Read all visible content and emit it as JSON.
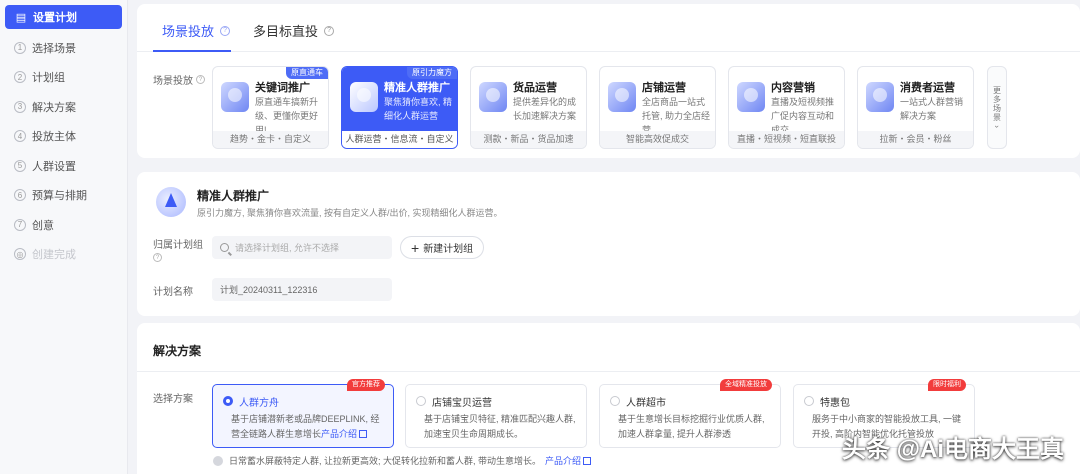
{
  "sidebar": {
    "steps": [
      {
        "num": "▤",
        "label": "设置计划"
      },
      {
        "num": "1",
        "label": "选择场景"
      },
      {
        "num": "2",
        "label": "计划组"
      },
      {
        "num": "3",
        "label": "解决方案"
      },
      {
        "num": "4",
        "label": "投放主体"
      },
      {
        "num": "5",
        "label": "人群设置"
      },
      {
        "num": "6",
        "label": "预算与排期"
      },
      {
        "num": "7",
        "label": "创意"
      },
      {
        "num": "◎",
        "label": "创建完成"
      }
    ]
  },
  "tabs": [
    {
      "label": "场景投放",
      "q": "?"
    },
    {
      "label": "多目标直投",
      "q": "?"
    }
  ],
  "scene": {
    "label": "场景投放",
    "q": "?",
    "cards": [
      {
        "title": "关键词推广",
        "desc": "原直通车搞新升级、更懂你更好用!",
        "foot": "趋势・金卡・自定义",
        "badge": "原直通车"
      },
      {
        "title": "精准人群推广",
        "desc": "聚焦猜你喜欢, 精细化人群运营",
        "foot": "人群运营・信息流・自定义",
        "badge": "原引力魔方"
      },
      {
        "title": "货品运营",
        "desc": "提供差异化的成长加速解决方案",
        "foot": "测款・新品・货品加速",
        "badge": ""
      },
      {
        "title": "店铺运营",
        "desc": "全店商品一站式托管, 助力全店经营",
        "foot": "智能高效促成交",
        "badge": ""
      },
      {
        "title": "内容营销",
        "desc": "直播及短视频推广促内容互动和成交",
        "foot": "直播・短视频・短直联投",
        "badge": ""
      },
      {
        "title": "消费者运营",
        "desc": "一站式人群营销解决方案",
        "foot": "拉新・会员・粉丝",
        "badge": ""
      }
    ],
    "more": "更多场景 ›"
  },
  "plan": {
    "title": "精准人群推广",
    "desc": "原引力魔方, 聚焦猜你喜欢流量, 按有自定义人群/出价, 实现精细化人群运营。",
    "group_label": "归属计划组",
    "group_q": "?",
    "group_placeholder": "请选择计划组, 允许不选择",
    "new_group": "新建计划组",
    "name_label": "计划名称",
    "name_value": "计划_20240311_122316"
  },
  "solution": {
    "title": "解决方案",
    "label": "选择方案",
    "options": [
      {
        "name": "人群方舟",
        "desc": "基于店铺潜新老或品牌DEEPLINK, 经营全链路人群生意增长",
        "link": "产品介绍",
        "tag": "官方推荐"
      },
      {
        "name": "店铺宝贝运营",
        "desc": "基于店铺宝贝特征, 精准匹配兴趣人群, 加速宝贝生命周期成长。",
        "link": "",
        "tag": ""
      },
      {
        "name": "人群超市",
        "desc": "基于生意增长目标挖掘行业优质人群, 加速人群拿量, 提升人群渗透",
        "link": "",
        "tag": "全域精准投放"
      },
      {
        "name": "特惠包",
        "desc": "服务于中小商家的智能投放工具, 一键开投, 高阶内智能优化托管投放",
        "link": "",
        "tag": "限时福利"
      }
    ],
    "tip": "日常蓄水屏蔽特定人群, 让拉新更高效; 大促转化拉新和蓄人群, 带动生意增长。",
    "tip_link": "产品介绍"
  },
  "watermark": "头条 @Ai电商大王真",
  "colors": {
    "accent": "#3d5bf6",
    "tag_red": "#f23c3c",
    "bg": "#f2f3f7"
  }
}
